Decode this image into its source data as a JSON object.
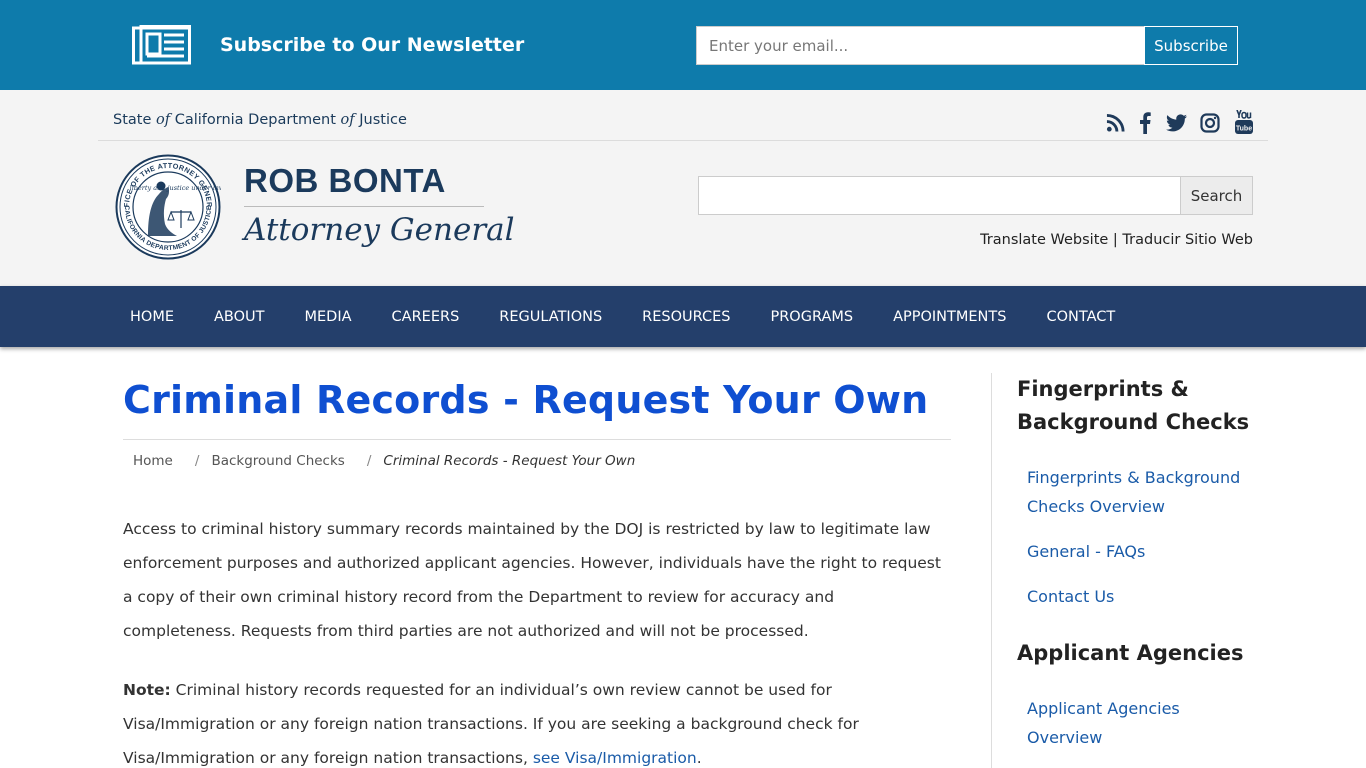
{
  "newsletter": {
    "title": "Subscribe to Our Newsletter",
    "email_placeholder": "Enter your email...",
    "subscribe_label": "Subscribe"
  },
  "header": {
    "state_prefix": "State ",
    "state_of_1": "of",
    "state_middle": " California Department ",
    "state_of_2": "of",
    "state_suffix": " Justice",
    "ag_name": "ROB BONTA",
    "ag_title": "Attorney General",
    "seal_text_outer": "OFFICE OF THE ATTORNEY GENERAL",
    "seal_text_inner": "CALIFORNIA DEPARTMENT OF JUSTICE",
    "seal_motto": "liberty and justice under law",
    "search_label": "Search",
    "translate_en": "Translate Website",
    "translate_sep": " | ",
    "translate_es": "Traducir Sitio Web",
    "social_icons": [
      "rss-icon",
      "facebook-icon",
      "twitter-icon",
      "instagram-icon",
      "youtube-icon"
    ]
  },
  "nav": {
    "items": [
      "HOME",
      "ABOUT",
      "MEDIA",
      "CAREERS",
      "REGULATIONS",
      "RESOURCES",
      "PROGRAMS",
      "APPOINTMENTS",
      "CONTACT"
    ]
  },
  "main": {
    "title": "Criminal Records - Request Your Own",
    "breadcrumb": {
      "home": "Home",
      "sep": "/",
      "parent": "Background Checks",
      "current": "Criminal Records - Request Your Own"
    },
    "para1": "Access to criminal history summary records maintained by the DOJ is restricted by law to legitimate law enforcement purposes and authorized applicant agencies. However, individuals have the right to request a copy of their own criminal history record from the Department to review for accuracy and completeness. Requests from third parties are not authorized and will not be processed.",
    "note_label": "Note:",
    "note_text": " Criminal history records requested for an individual’s own review cannot be used for Visa/Immigration or any foreign nation transactions. If you are seeking a background check for Visa/Immigration or any foreign nation transactions, ",
    "note_link": "see Visa/Immigration",
    "note_end": "."
  },
  "sidebar": {
    "heading1_line1": "Fingerprints &",
    "heading1_line2": "Background Checks",
    "link1_line1": "Fingerprints & Background",
    "link1_line2": "Checks Overview",
    "link2": "General - FAQs",
    "link3": "Contact Us",
    "heading2": "Applicant Agencies",
    "link4_line1": "Applicant Agencies",
    "link4_line2": "Overview"
  },
  "colors": {
    "newsletter_bg": "#0e7bab",
    "nav_bg": "#243f6b",
    "title": "#0f4fd1",
    "link": "#1a5ba8",
    "brand_navy": "#1b3a5c"
  }
}
